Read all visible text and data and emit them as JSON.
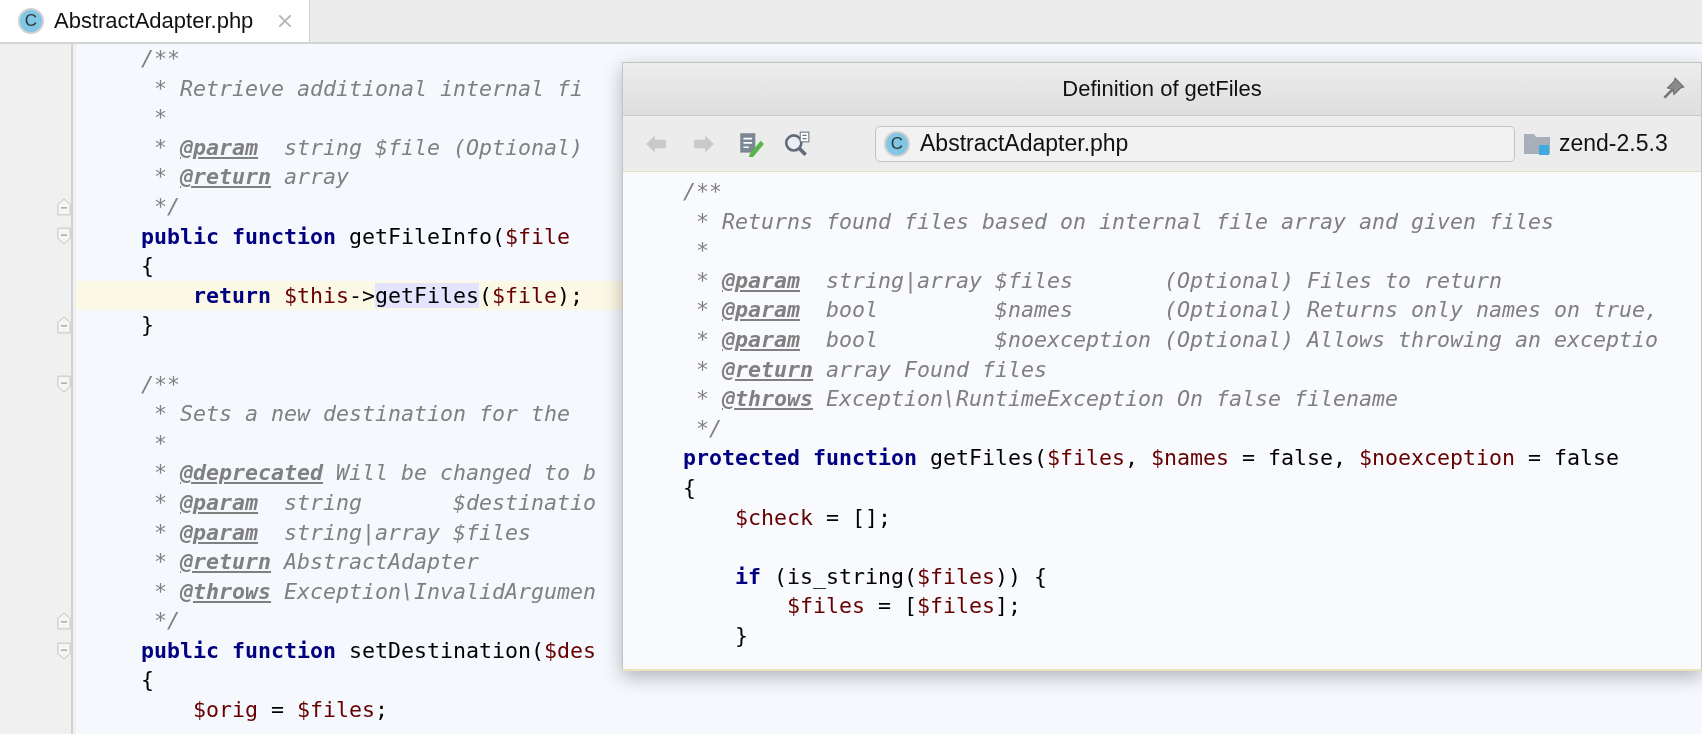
{
  "tab": {
    "icon_letter": "C",
    "label": "AbstractAdapter.php",
    "selected": true
  },
  "editor": {
    "lines": [
      {
        "kind": "code",
        "current": false,
        "segments": [
          {
            "kind": "comment",
            "text": "    /**"
          }
        ]
      },
      {
        "kind": "code",
        "current": false,
        "segments": [
          {
            "kind": "comment",
            "text": "     * Retrieve additional internal fi"
          }
        ]
      },
      {
        "kind": "code",
        "current": false,
        "segments": [
          {
            "kind": "comment",
            "text": "     *"
          }
        ]
      },
      {
        "kind": "code",
        "current": false,
        "segments": [
          {
            "kind": "comment",
            "text": "     * "
          },
          {
            "kind": "tag",
            "text": "@param"
          },
          {
            "kind": "comment",
            "text": "  string $file (Optional)"
          }
        ]
      },
      {
        "kind": "code",
        "current": false,
        "segments": [
          {
            "kind": "comment",
            "text": "     * "
          },
          {
            "kind": "tag",
            "text": "@return"
          },
          {
            "kind": "comment",
            "text": " array"
          }
        ]
      },
      {
        "kind": "code",
        "current": false,
        "fold_end": true,
        "segments": [
          {
            "kind": "comment",
            "text": "     */"
          }
        ]
      },
      {
        "kind": "code",
        "current": false,
        "fold_start": true,
        "segments": [
          {
            "kind": "keyword",
            "text": "    public function"
          },
          {
            "kind": "plain",
            "text": " getFileInfo("
          },
          {
            "kind": "var",
            "text": "$file"
          }
        ]
      },
      {
        "kind": "code",
        "current": false,
        "segments": [
          {
            "kind": "plain",
            "text": "    {"
          }
        ]
      },
      {
        "kind": "code",
        "current": true,
        "segments": [
          {
            "kind": "keyword",
            "text": "        return "
          },
          {
            "kind": "var",
            "text": "$this"
          },
          {
            "kind": "plain",
            "text": "->"
          },
          {
            "kind": "usage",
            "text": "getFiles"
          },
          {
            "kind": "plain",
            "text": "("
          },
          {
            "kind": "var",
            "text": "$file"
          },
          {
            "kind": "plain",
            "text": ");"
          }
        ]
      },
      {
        "kind": "code",
        "current": false,
        "fold_end": true,
        "segments": [
          {
            "kind": "plain",
            "text": "    }"
          }
        ]
      },
      {
        "kind": "blank",
        "current": false
      },
      {
        "kind": "code",
        "current": false,
        "fold_start": true,
        "segments": [
          {
            "kind": "comment",
            "text": "    /**"
          }
        ]
      },
      {
        "kind": "code",
        "current": false,
        "segments": [
          {
            "kind": "comment",
            "text": "     * Sets a new destination for the"
          }
        ]
      },
      {
        "kind": "code",
        "current": false,
        "segments": [
          {
            "kind": "comment",
            "text": "     *"
          }
        ]
      },
      {
        "kind": "code",
        "current": false,
        "segments": [
          {
            "kind": "comment",
            "text": "     * "
          },
          {
            "kind": "tag",
            "text": "@deprecated"
          },
          {
            "kind": "comment",
            "text": " Will be changed to b"
          }
        ]
      },
      {
        "kind": "code",
        "current": false,
        "segments": [
          {
            "kind": "comment",
            "text": "     * "
          },
          {
            "kind": "tag",
            "text": "@param"
          },
          {
            "kind": "comment",
            "text": "  string       $destinatio"
          }
        ]
      },
      {
        "kind": "code",
        "current": false,
        "segments": [
          {
            "kind": "comment",
            "text": "     * "
          },
          {
            "kind": "tag",
            "text": "@param"
          },
          {
            "kind": "comment",
            "text": "  string|array $files"
          }
        ]
      },
      {
        "kind": "code",
        "current": false,
        "segments": [
          {
            "kind": "comment",
            "text": "     * "
          },
          {
            "kind": "tag",
            "text": "@return"
          },
          {
            "kind": "comment",
            "text": " AbstractAdapter"
          }
        ]
      },
      {
        "kind": "code",
        "current": false,
        "segments": [
          {
            "kind": "comment",
            "text": "     * "
          },
          {
            "kind": "tag",
            "text": "@throws"
          },
          {
            "kind": "comment",
            "text": " Exception\\InvalidArgumen"
          }
        ]
      },
      {
        "kind": "code",
        "current": false,
        "fold_end": true,
        "segments": [
          {
            "kind": "comment",
            "text": "     */"
          }
        ]
      },
      {
        "kind": "code",
        "current": false,
        "fold_start": true,
        "segments": [
          {
            "kind": "keyword",
            "text": "    public function"
          },
          {
            "kind": "plain",
            "text": " setDestination("
          },
          {
            "kind": "var",
            "text": "$des"
          }
        ]
      },
      {
        "kind": "code",
        "current": false,
        "segments": [
          {
            "kind": "plain",
            "text": "    {"
          }
        ]
      },
      {
        "kind": "code",
        "current": false,
        "segments": [
          {
            "kind": "var",
            "text": "        $orig"
          },
          {
            "kind": "plain",
            "text": " = "
          },
          {
            "kind": "var",
            "text": "$files"
          },
          {
            "kind": "plain",
            "text": ";"
          }
        ]
      }
    ]
  },
  "popup": {
    "title": "Definition of getFiles",
    "toolbar": {
      "back_disabled": true,
      "forward_disabled": true
    },
    "file": {
      "icon_letter": "C",
      "name": "AbstractAdapter.php"
    },
    "project": "zend-2.5.3",
    "lines": [
      {
        "kind": "code",
        "segments": [
          {
            "kind": "comment",
            "text": "/**"
          }
        ]
      },
      {
        "kind": "code",
        "segments": [
          {
            "kind": "comment",
            "text": " * Returns found files based on internal file array and given files"
          }
        ]
      },
      {
        "kind": "code",
        "segments": [
          {
            "kind": "comment",
            "text": " *"
          }
        ]
      },
      {
        "kind": "code",
        "segments": [
          {
            "kind": "comment",
            "text": " * "
          },
          {
            "kind": "tag",
            "text": "@param"
          },
          {
            "kind": "comment",
            "text": "  string|array $files       (Optional) Files to return"
          }
        ]
      },
      {
        "kind": "code",
        "segments": [
          {
            "kind": "comment",
            "text": " * "
          },
          {
            "kind": "tag",
            "text": "@param"
          },
          {
            "kind": "comment",
            "text": "  bool         $names       (Optional) Returns only names on true,"
          }
        ]
      },
      {
        "kind": "code",
        "segments": [
          {
            "kind": "comment",
            "text": " * "
          },
          {
            "kind": "tag",
            "text": "@param"
          },
          {
            "kind": "comment",
            "text": "  bool         $noexception (Optional) Allows throwing an exceptio"
          }
        ]
      },
      {
        "kind": "code",
        "segments": [
          {
            "kind": "comment",
            "text": " * "
          },
          {
            "kind": "tag",
            "text": "@return"
          },
          {
            "kind": "comment",
            "text": " array Found files"
          }
        ]
      },
      {
        "kind": "code",
        "segments": [
          {
            "kind": "comment",
            "text": " * "
          },
          {
            "kind": "tag",
            "text": "@throws"
          },
          {
            "kind": "comment",
            "text": " Exception\\RuntimeException On false filename"
          }
        ]
      },
      {
        "kind": "code",
        "segments": [
          {
            "kind": "comment",
            "text": " */"
          }
        ]
      },
      {
        "kind": "code",
        "segments": [
          {
            "kind": "keyword",
            "text": "protected function"
          },
          {
            "kind": "plain",
            "text": " getFiles("
          },
          {
            "kind": "var",
            "text": "$files"
          },
          {
            "kind": "plain",
            "text": ", "
          },
          {
            "kind": "var",
            "text": "$names"
          },
          {
            "kind": "plain",
            "text": " = false, "
          },
          {
            "kind": "var",
            "text": "$noexception"
          },
          {
            "kind": "plain",
            "text": " = false"
          }
        ]
      },
      {
        "kind": "code",
        "segments": [
          {
            "kind": "plain",
            "text": "{"
          }
        ]
      },
      {
        "kind": "code",
        "segments": [
          {
            "kind": "var",
            "text": "    $check"
          },
          {
            "kind": "plain",
            "text": " = [];"
          }
        ]
      },
      {
        "kind": "blank"
      },
      {
        "kind": "code",
        "segments": [
          {
            "kind": "keyword",
            "text": "    if"
          },
          {
            "kind": "plain",
            "text": " (is_string("
          },
          {
            "kind": "var",
            "text": "$files"
          },
          {
            "kind": "plain",
            "text": ")) {"
          }
        ]
      },
      {
        "kind": "code",
        "segments": [
          {
            "kind": "var",
            "text": "        $files"
          },
          {
            "kind": "plain",
            "text": " = ["
          },
          {
            "kind": "var",
            "text": "$files"
          },
          {
            "kind": "plain",
            "text": "];"
          }
        ]
      },
      {
        "kind": "code",
        "segments": [
          {
            "kind": "plain",
            "text": "    }"
          }
        ]
      }
    ]
  }
}
